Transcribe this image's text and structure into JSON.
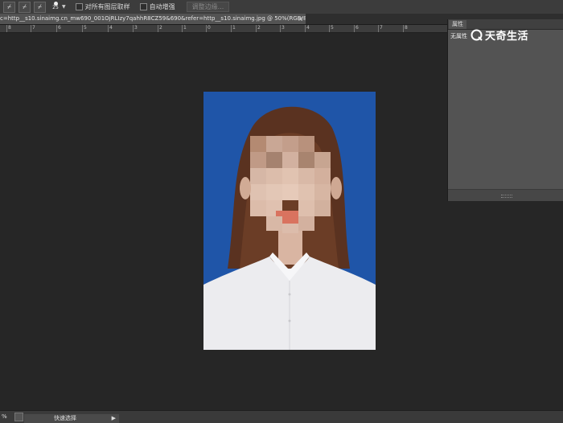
{
  "options_bar": {
    "brush_size": "25",
    "sample_all_layers_label": "对所有图层取样",
    "auto_enhance_label": "自动增强",
    "refine_edge_label": "调整边缘..."
  },
  "document_tab": {
    "title": "c=http__s10.sinaimg.cn_mw690_001OjRLIzy7qahhR8CZ59&690&refer=http__s10.sinaimg.jpg @ 50%(RGB/8)",
    "close": "×"
  },
  "ruler": {
    "ticks": [
      "8",
      "7",
      "6",
      "5",
      "4",
      "3",
      "2",
      "1",
      "0",
      "1",
      "2",
      "3",
      "4",
      "5",
      "6",
      "7",
      "8"
    ]
  },
  "properties_panel": {
    "tab_label": "属性",
    "body_text": "无属性"
  },
  "watermark": {
    "text": "天奇生活"
  },
  "status_bar": {
    "zoom": "%",
    "tab_label": "快速选择",
    "play": "▶"
  },
  "colors": {
    "workspace": "#262626",
    "photo_background": "#1f55a8",
    "panel": "#535353"
  }
}
